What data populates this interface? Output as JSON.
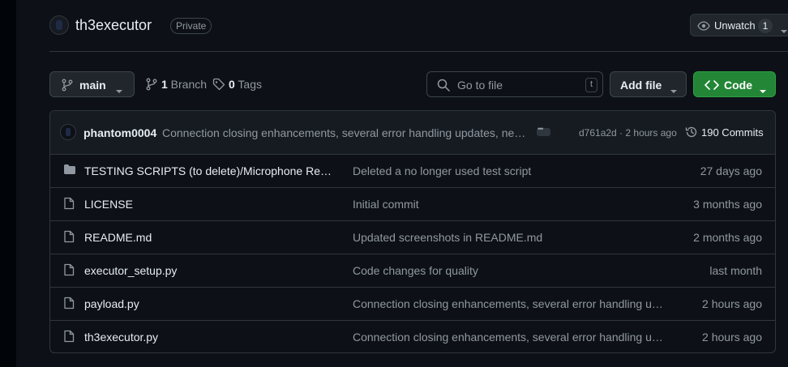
{
  "repo": {
    "name": "th3executor",
    "visibility": "Private"
  },
  "watch": {
    "label": "Unwatch",
    "count": "1"
  },
  "toolbar": {
    "branch": "main",
    "branches_count": "1",
    "branches_label": " Branch",
    "tags_count": "0",
    "tags_label": " Tags",
    "search_placeholder": "Go to file",
    "search_shortcut": "t",
    "add_file_label": "Add file",
    "code_label": "Code"
  },
  "latest_commit": {
    "author": "phantom0004",
    "message": "Connection closing enhancements, several error handling updates, needed fixes",
    "hash_time": "d761a2d · 2 hours ago",
    "commits_label": "190 Commits"
  },
  "files": [
    {
      "type": "folder",
      "name": "TESTING SCRIPTS (to delete)/Microphone Recorder",
      "message": "Deleted a no longer used test script",
      "date": "27 days ago"
    },
    {
      "type": "file",
      "name": "LICENSE",
      "message": "Initial commit",
      "date": "3 months ago"
    },
    {
      "type": "file",
      "name": "README.md",
      "message": "Updated screenshots in README.md",
      "date": "2 months ago"
    },
    {
      "type": "file",
      "name": "executor_setup.py",
      "message": "Code changes for quality",
      "date": "last month"
    },
    {
      "type": "file",
      "name": "payload.py",
      "message": "Connection closing enhancements, several error handling updates",
      "date": "2 hours ago"
    },
    {
      "type": "file",
      "name": "th3executor.py",
      "message": "Connection closing enhancements, several error handling updates",
      "date": "2 hours ago"
    }
  ],
  "colors": {
    "background": "#0d1117",
    "code_button": "#238636",
    "border": "#30363d",
    "muted_text": "#9198a1"
  },
  "icons": {
    "folder": "folder-icon",
    "file": "file-icon",
    "branch": "branch-icon",
    "tag": "tag-icon",
    "search": "search-icon",
    "history": "history-icon",
    "eye": "eye-icon",
    "code": "code-icon"
  }
}
